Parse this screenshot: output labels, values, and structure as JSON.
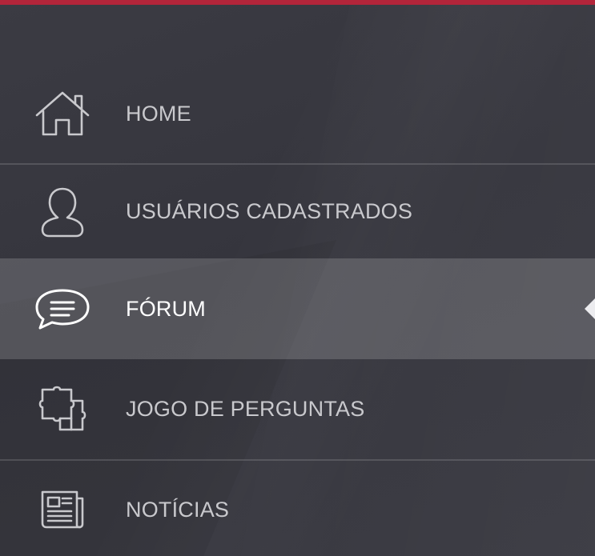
{
  "colors": {
    "accent_bar": "#b3253a",
    "background": "#383840",
    "active_background": "#5a5a62",
    "label": "#c9c9cd",
    "label_active": "#ffffff"
  },
  "menu": {
    "items": [
      {
        "label": "HOME",
        "icon": "home-icon",
        "active": false
      },
      {
        "label": "USUÁRIOS CADASTRADOS",
        "icon": "user-icon",
        "active": false
      },
      {
        "label": "FÓRUM",
        "icon": "chat-bubble-icon",
        "active": true
      },
      {
        "label": "JOGO DE PERGUNTAS",
        "icon": "puzzle-icon",
        "active": false
      },
      {
        "label": "NOTÍCIAS",
        "icon": "newspaper-icon",
        "active": false
      }
    ]
  }
}
